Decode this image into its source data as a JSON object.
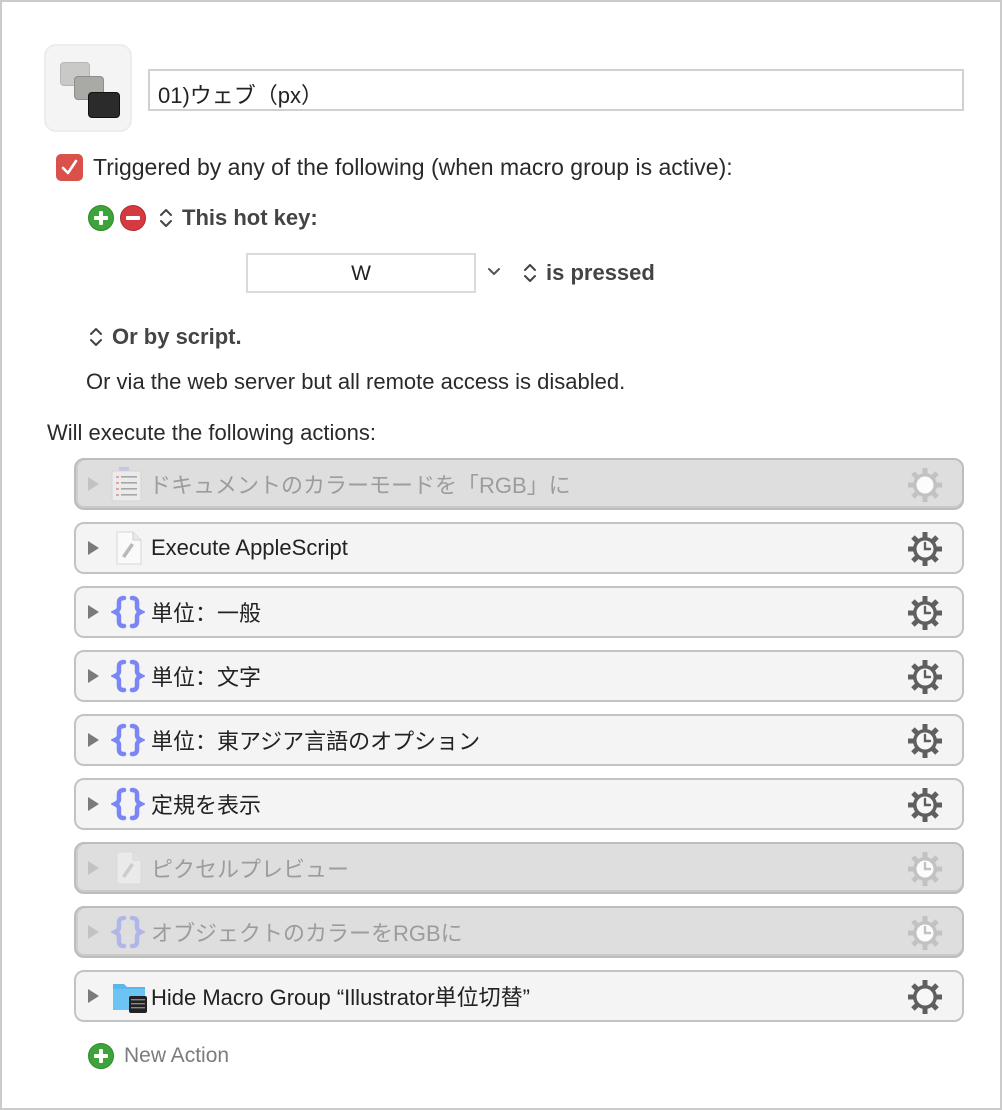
{
  "macro": {
    "icon": "keyboard-keys-icon",
    "name": "01)ウェブ（px）"
  },
  "trigger": {
    "checked": true,
    "label": "Triggered by any of the following (when macro group is active):",
    "hotkey_label": "This hot key:",
    "hotkey_value": "W",
    "hotkey_condition": "is pressed",
    "script_label": "Or by script.",
    "webserver_note": "Or via the web server but all remote access is disabled."
  },
  "actions_header": "Will execute the following actions:",
  "actions": [
    {
      "label": "ドキュメントのカラーモードを「RGB」に",
      "icon": "list-document-icon",
      "enabled": false,
      "gear": "gear-icon"
    },
    {
      "label": "Execute AppleScript",
      "icon": "applescript-file-icon",
      "enabled": true,
      "gear": "gear-clock-icon"
    },
    {
      "label": "単位：一般",
      "icon": "braces-icon",
      "enabled": true,
      "gear": "gear-clock-icon"
    },
    {
      "label": "単位：文字",
      "icon": "braces-icon",
      "enabled": true,
      "gear": "gear-clock-icon"
    },
    {
      "label": "単位：東アジア言語のオプション",
      "icon": "braces-icon",
      "enabled": true,
      "gear": "gear-clock-icon"
    },
    {
      "label": "定規を表示",
      "icon": "braces-icon",
      "enabled": true,
      "gear": "gear-clock-icon"
    },
    {
      "label": "ピクセルプレビュー",
      "icon": "applescript-file-icon",
      "enabled": false,
      "gear": "gear-clock-icon"
    },
    {
      "label": "オブジェクトのカラーをRGBに",
      "icon": "braces-icon",
      "enabled": false,
      "gear": "gear-clock-icon"
    },
    {
      "label": "Hide Macro Group “Illustrator単位切替”",
      "icon": "macro-group-folder-icon",
      "enabled": true,
      "gear": "gear-icon"
    }
  ],
  "new_action_label": "New Action",
  "colors": {
    "checkbox": "#d9514a",
    "add": "#3ea33a",
    "remove": "#d33b40",
    "braces": "#7a86f5",
    "gear": "#5f5f5f"
  }
}
